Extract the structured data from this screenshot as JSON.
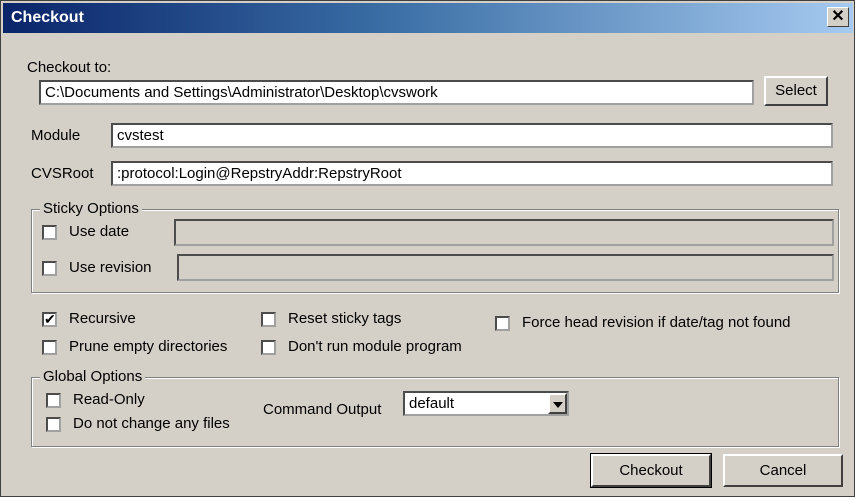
{
  "window": {
    "title": "Checkout",
    "close_glyph": "✕"
  },
  "checkout_to": {
    "label": "Checkout to:",
    "value": "C:\\Documents and Settings\\Administrator\\Desktop\\cvswork",
    "select_label": "Select"
  },
  "module": {
    "label": "Module",
    "value": "cvstest"
  },
  "cvsroot": {
    "label": "CVSRoot",
    "value": ":protocol:Login@RepstryAddr:RepstryRoot"
  },
  "sticky": {
    "caption": "Sticky Options",
    "use_date": {
      "label": "Use date",
      "checked": false
    },
    "use_revision": {
      "label": "Use revision",
      "checked": false
    }
  },
  "options": {
    "recursive": {
      "label": "Recursive",
      "checked": true
    },
    "prune": {
      "label": "Prune empty directories",
      "checked": false
    },
    "reset_sticky": {
      "label": "Reset sticky tags",
      "checked": false
    },
    "dont_run": {
      "label": "Don't run module program",
      "checked": false
    },
    "force_head": {
      "label": "Force head revision if date/tag not found",
      "checked": false
    }
  },
  "global": {
    "caption": "Global Options",
    "read_only": {
      "label": "Read-Only",
      "checked": false
    },
    "no_change": {
      "label": "Do not change any files",
      "checked": false
    },
    "command_output_label": "Command Output",
    "command_output_value": "default"
  },
  "buttons": {
    "checkout": "Checkout",
    "cancel": "Cancel"
  },
  "check_glyph": "✔"
}
